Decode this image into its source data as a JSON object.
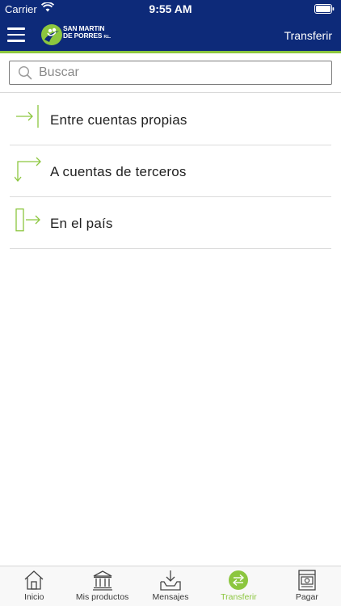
{
  "status_bar": {
    "carrier": "Carrier",
    "time": "9:55 AM"
  },
  "header": {
    "logo_line1": "SAN MARTIN",
    "logo_line2": "DE PORRES",
    "logo_suffix": "R.L.",
    "title": "Transferir"
  },
  "search": {
    "placeholder": "Buscar",
    "value": ""
  },
  "options": [
    {
      "label": "Entre cuentas propias",
      "icon": "arrow-into-bar-icon"
    },
    {
      "label": "A cuentas de terceros",
      "icon": "redirect-arrows-icon"
    },
    {
      "label": "En el país",
      "icon": "arrow-out-of-box-icon"
    }
  ],
  "tabs": [
    {
      "label": "Inicio",
      "icon": "home-icon",
      "active": false
    },
    {
      "label": "Mis productos",
      "icon": "bank-icon",
      "active": false
    },
    {
      "label": "Mensajes",
      "icon": "inbox-download-icon",
      "active": false
    },
    {
      "label": "Transferir",
      "icon": "transfer-icon",
      "active": true
    },
    {
      "label": "Pagar",
      "icon": "payment-icon",
      "active": false
    }
  ],
  "colors": {
    "brand_navy": "#0d2a79",
    "accent_green": "#8cc63f"
  }
}
